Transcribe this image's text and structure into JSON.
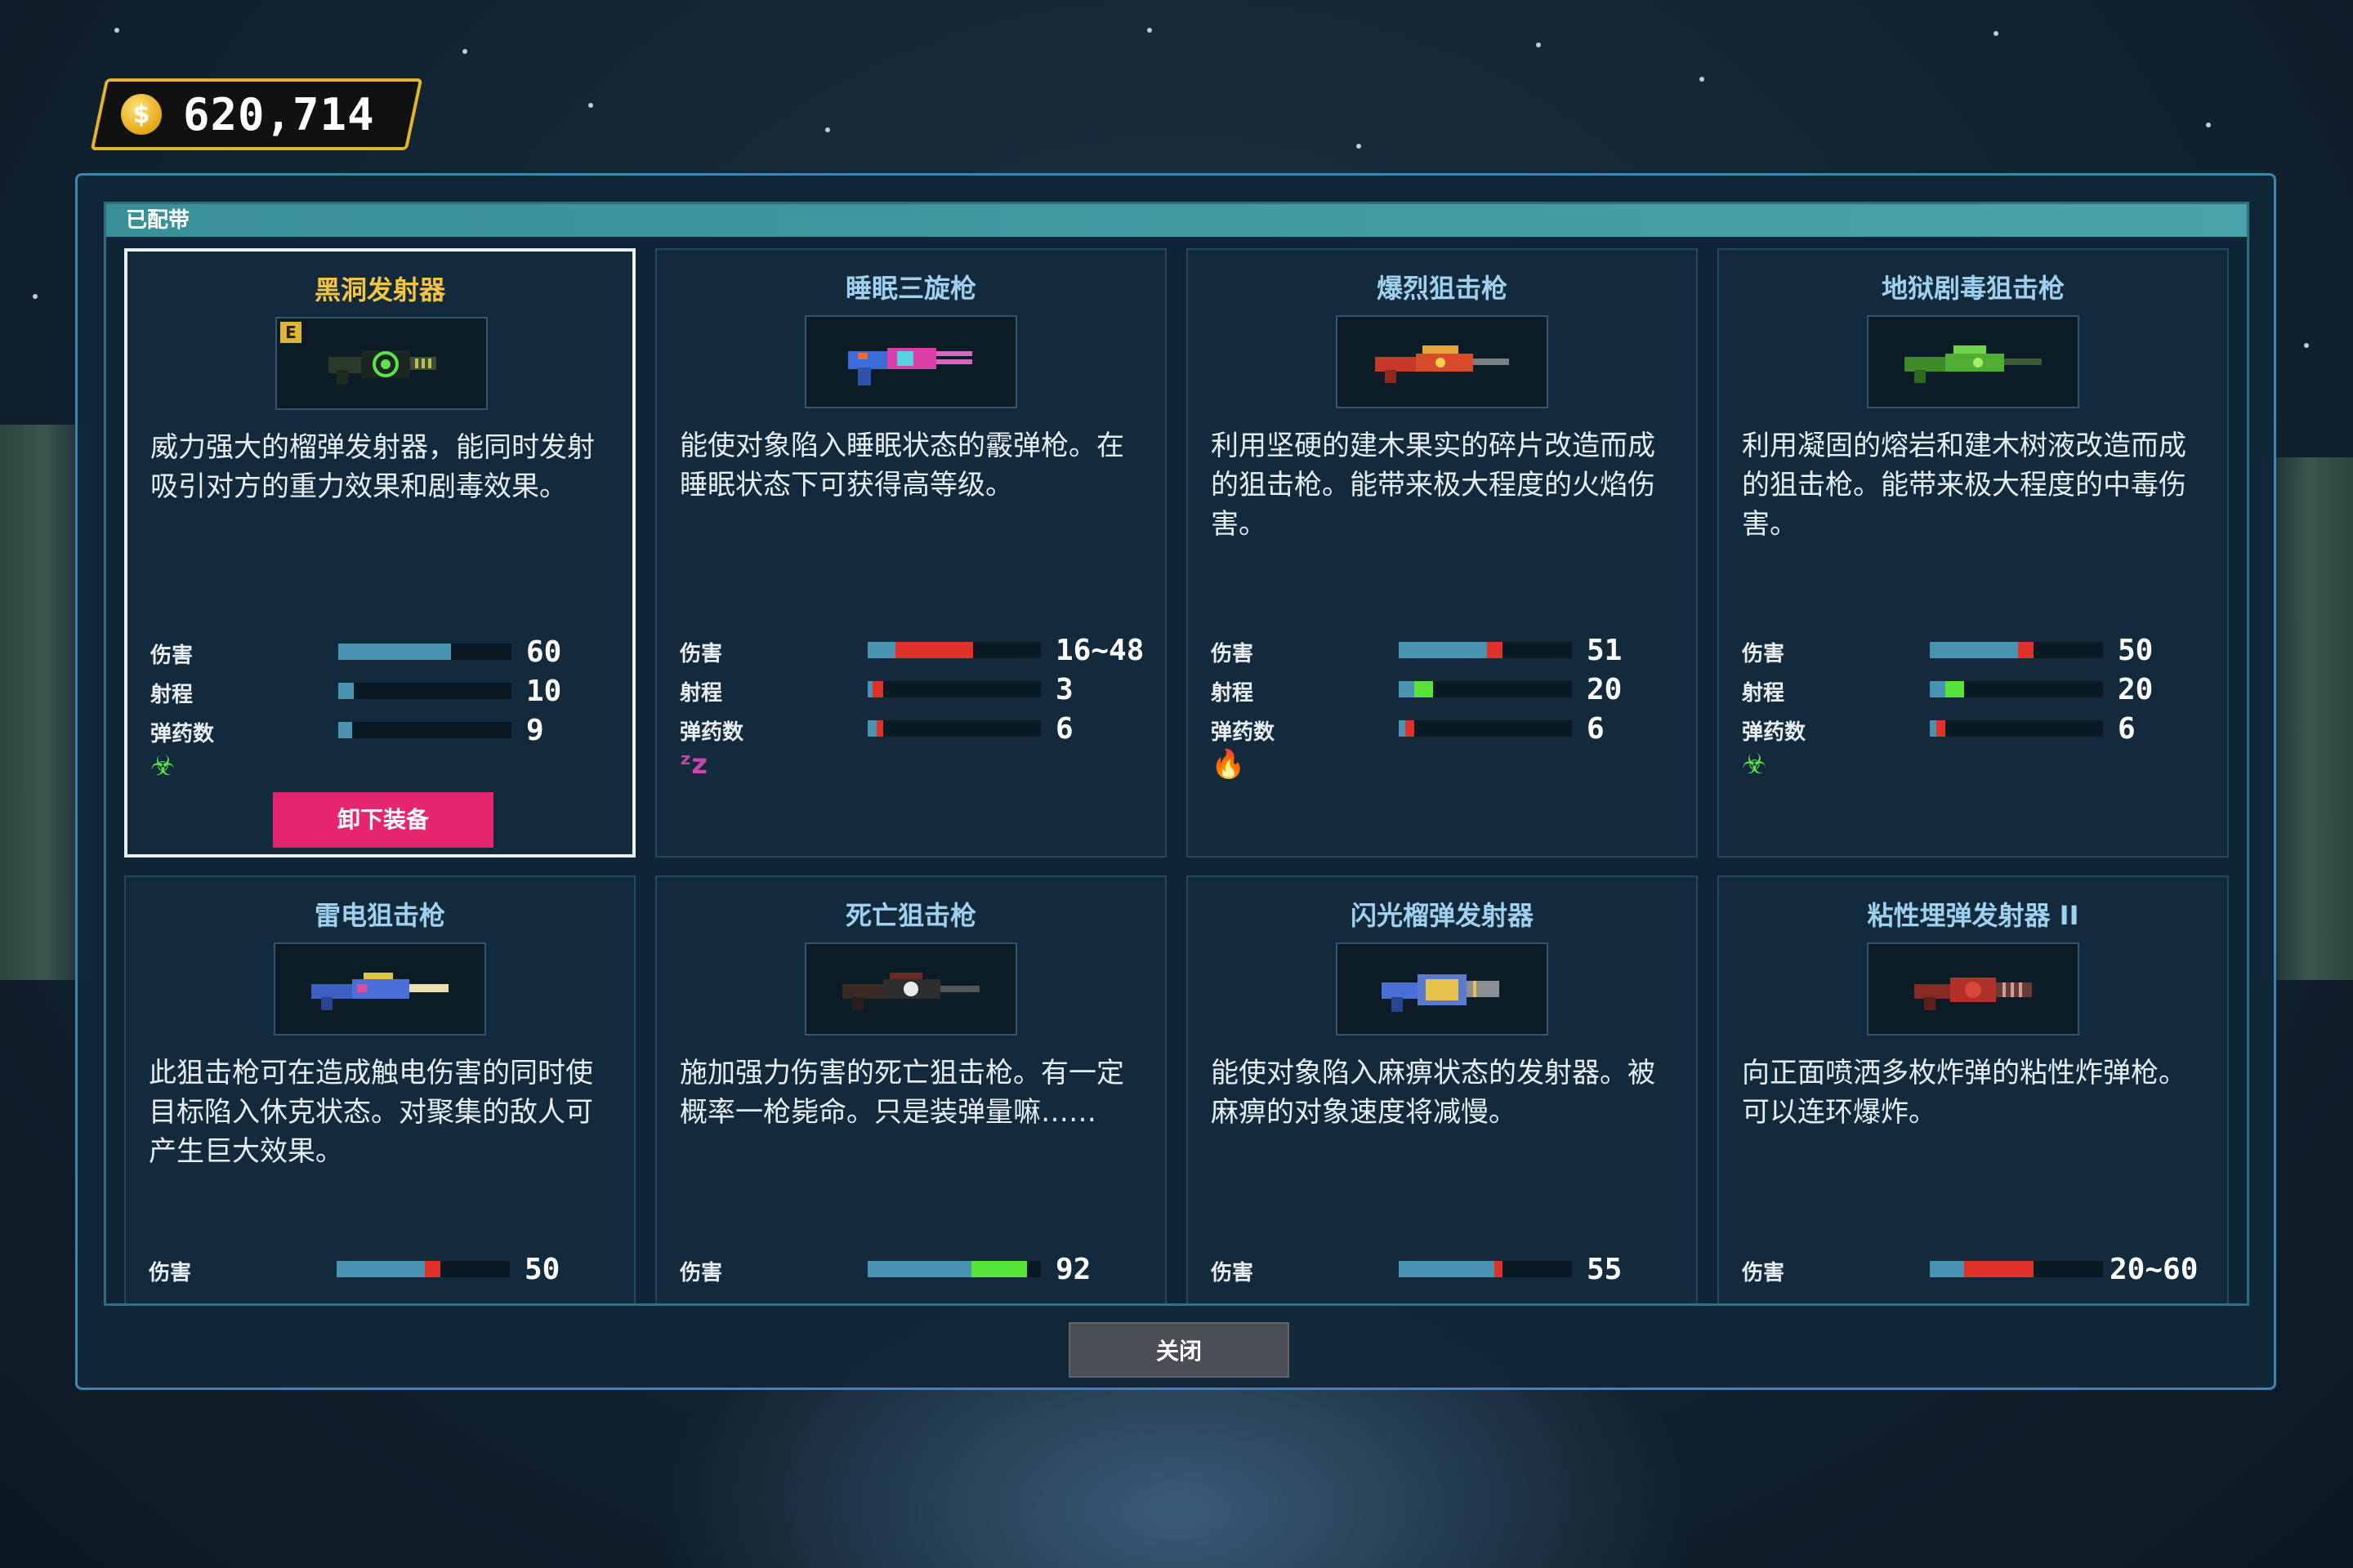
{
  "currency": {
    "amount": "620,714",
    "icon": "coin-icon",
    "symbol": "$"
  },
  "section_title": "已配带",
  "close_label": "关闭",
  "unequip_label": "卸下装备",
  "stat_labels": {
    "damage": "伤害",
    "range": "射程",
    "ammo": "弹药数"
  },
  "weapons": [
    {
      "name": "黑洞发射器",
      "equipped": true,
      "badge": "E",
      "desc": "威力强大的榴弹发射器，能同时发射吸引对方的重力效果和剧毒效果。",
      "stats": {
        "damage": "60",
        "range": "10",
        "ammo": "9"
      },
      "effect_icon": "biohazard-icon",
      "effect_glyph": "☣"
    },
    {
      "name": "睡眠三旋枪",
      "equipped": false,
      "desc": "能使对象陷入睡眠状态的霰弹枪。在睡眠状态下可获得高等级。",
      "stats": {
        "damage": "16~48",
        "range": "3",
        "ammo": "6"
      },
      "effect_icon": "sleep-icon",
      "effect_glyph": "ᶻz"
    },
    {
      "name": "爆烈狙击枪",
      "equipped": false,
      "desc": "利用坚硬的建木果实的碎片改造而成的狙击枪。能带来极大程度的火焰伤害。",
      "stats": {
        "damage": "51",
        "range": "20",
        "ammo": "6"
      },
      "effect_icon": "fire-icon",
      "effect_glyph": "🔥"
    },
    {
      "name": "地狱剧毒狙击枪",
      "equipped": false,
      "desc": "利用凝固的熔岩和建木树液改造而成的狙击枪。能带来极大程度的中毒伤害。",
      "stats": {
        "damage": "50",
        "range": "20",
        "ammo": "6"
      },
      "effect_icon": "biohazard-icon",
      "effect_glyph": "☣"
    },
    {
      "name": "雷电狙击枪",
      "equipped": false,
      "desc": "此狙击枪可在造成触电伤害的同时使目标陷入休克状态。对聚集的敌人可产生巨大效果。",
      "stats": {
        "damage": "50"
      }
    },
    {
      "name": "死亡狙击枪",
      "equipped": false,
      "desc": "施加强力伤害的死亡狙击枪。有一定概率一枪毙命。只是装弹量嘛……",
      "stats": {
        "damage": "92"
      }
    },
    {
      "name": "闪光榴弹发射器",
      "equipped": false,
      "desc": "能使对象陷入麻痹状态的发射器。被麻痹的对象速度将减慢。",
      "stats": {
        "damage": "55"
      }
    },
    {
      "name": "粘性埋弹发射器 II",
      "equipped": false,
      "desc": "向正面喷洒多枚炸弹的粘性炸弹枪。可以连环爆炸。",
      "stats": {
        "damage": "20~60"
      }
    }
  ],
  "colors": {
    "accent_pink": "#e5266f",
    "gold": "#e2b52c",
    "bar_base": "#4a93b3",
    "bar_up": "#57e33a",
    "bar_down": "#e0302a"
  }
}
